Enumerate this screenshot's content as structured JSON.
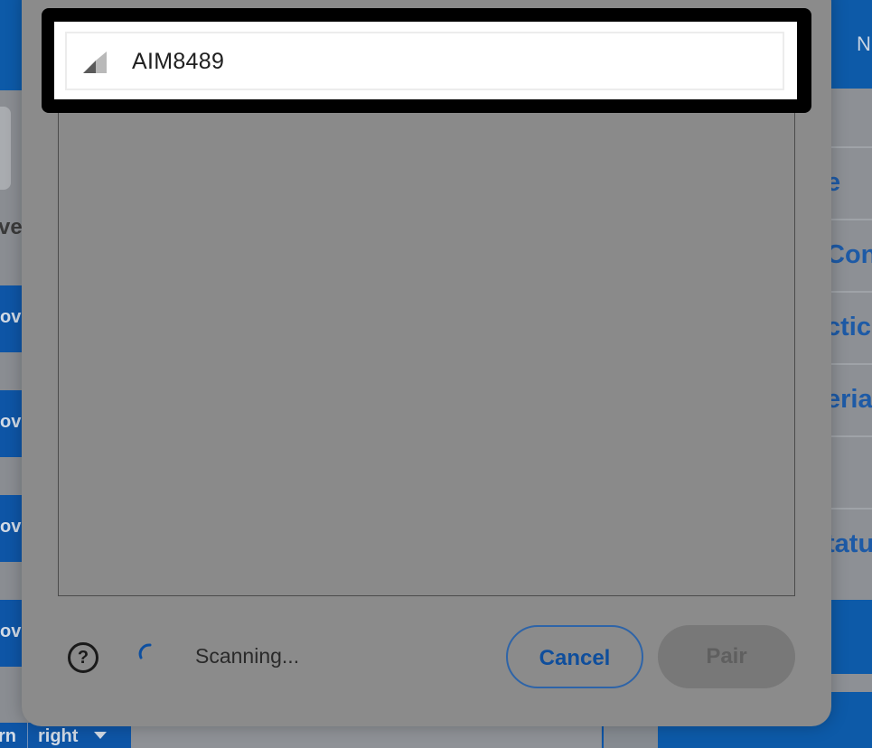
{
  "background": {
    "left_category_label": "ve",
    "left_block_labels": [
      "ov",
      "ov",
      "ov",
      "ov"
    ],
    "bottom_block": {
      "label1": "rn",
      "label2": "right"
    },
    "right_header_text": "N",
    "right_rows": [
      "e",
      "Con",
      "ctic",
      "erial",
      "",
      "tatu"
    ]
  },
  "dialog": {
    "device": {
      "name": "AIM8489",
      "icon": "signal-strength-icon"
    },
    "status_text": "Scanning...",
    "help_icon": "question-circle-icon",
    "help_glyph": "?",
    "spinner_icon": "spinner-icon",
    "cancel_label": "Cancel",
    "pair_label": "Pair"
  },
  "colors": {
    "accent_blue": "#0d5aa8",
    "highlight_frame": "#000000"
  }
}
